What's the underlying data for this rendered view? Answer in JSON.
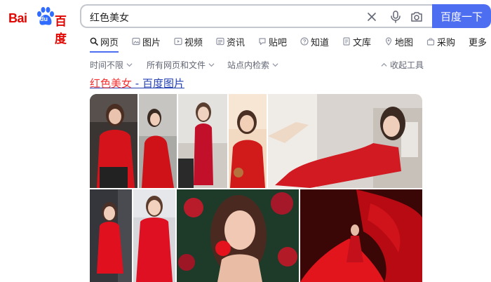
{
  "logo": {
    "bai": "Bai",
    "du": "du",
    "cn": "百度"
  },
  "search": {
    "query": "红色美女",
    "button_label": "百度一下"
  },
  "tabs": [
    {
      "label": "网页",
      "icon": "search-icon",
      "active": true
    },
    {
      "label": "图片",
      "icon": "image-icon"
    },
    {
      "label": "视频",
      "icon": "video-icon"
    },
    {
      "label": "资讯",
      "icon": "news-icon"
    },
    {
      "label": "贴吧",
      "icon": "tieba-icon"
    },
    {
      "label": "知道",
      "icon": "question-icon"
    },
    {
      "label": "文库",
      "icon": "doc-icon"
    },
    {
      "label": "地图",
      "icon": "map-icon"
    },
    {
      "label": "采购",
      "icon": "bag-icon"
    },
    {
      "label": "更多"
    }
  ],
  "filters": {
    "time": "时间不限",
    "type": "所有网页和文件",
    "site": "站点内检索",
    "collapse": "收起工具"
  },
  "result": {
    "title_em": "红色美女",
    "title_rest": " - 百度图片"
  },
  "colors": {
    "brand_red": "#e10602",
    "brand_blue": "#4e6ef2",
    "link_blue": "#2440b3",
    "highlight_red": "#f73131"
  }
}
